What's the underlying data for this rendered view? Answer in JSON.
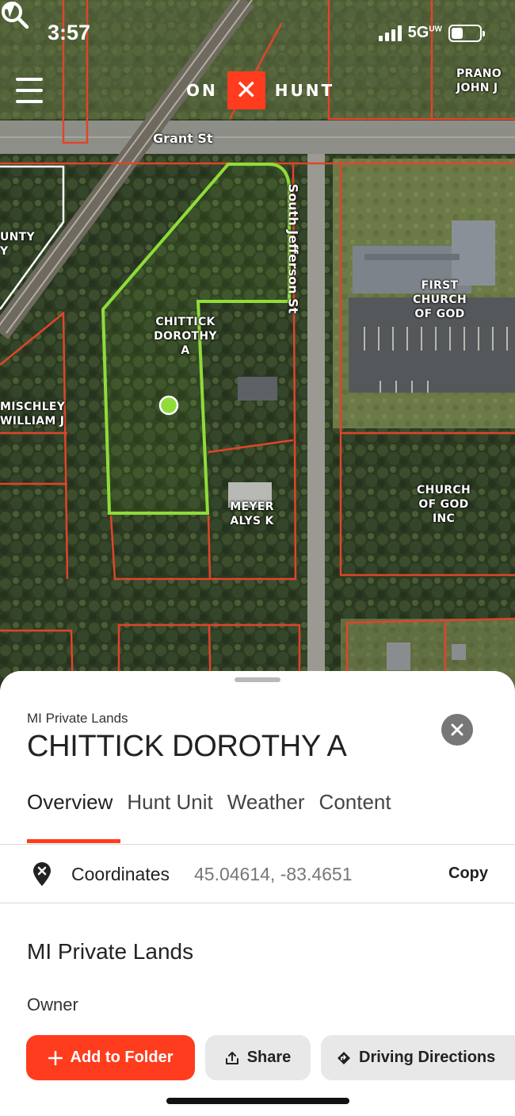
{
  "status_bar": {
    "time": "3:57",
    "network": "5G",
    "network_sup": "UW",
    "battery_level": 0.4
  },
  "app_bar": {
    "logo_left": "ON",
    "logo_mark": "✕",
    "logo_right": "HUNT"
  },
  "map": {
    "roads": {
      "grant": "Grant St",
      "jefferson": "South Jefferson St"
    },
    "parcel_labels": {
      "prano": "PRANO\nJOHN J",
      "county": "UNTY\nY",
      "chittick": "CHITTICK\nDOROTHY\nA",
      "first_church": "FIRST\nCHURCH\nOF GOD",
      "mischley": "MISCHLEY\nWILLIAM J",
      "meyer": "MEYER\nALYS K",
      "church_inc": "CHURCH\nOF GOD\nINC"
    },
    "colors": {
      "selected_parcel": "#8fdc3a",
      "parcel_lines": "#e0452a",
      "accent": "#ff3c1e"
    }
  },
  "sheet": {
    "layer_name": "MI Private Lands",
    "title": "CHITTICK DOROTHY A",
    "tabs": [
      "Overview",
      "Hunt Unit",
      "Weather",
      "Content"
    ],
    "active_tab": "Overview",
    "coordinates": {
      "label": "Coordinates",
      "value": "45.04614, -83.4651",
      "copy_label": "Copy"
    },
    "section_title": "MI Private Lands",
    "owner_label": "Owner",
    "actions": {
      "add_to_folder": "Add to Folder",
      "share": "Share",
      "driving_directions": "Driving Directions"
    }
  }
}
